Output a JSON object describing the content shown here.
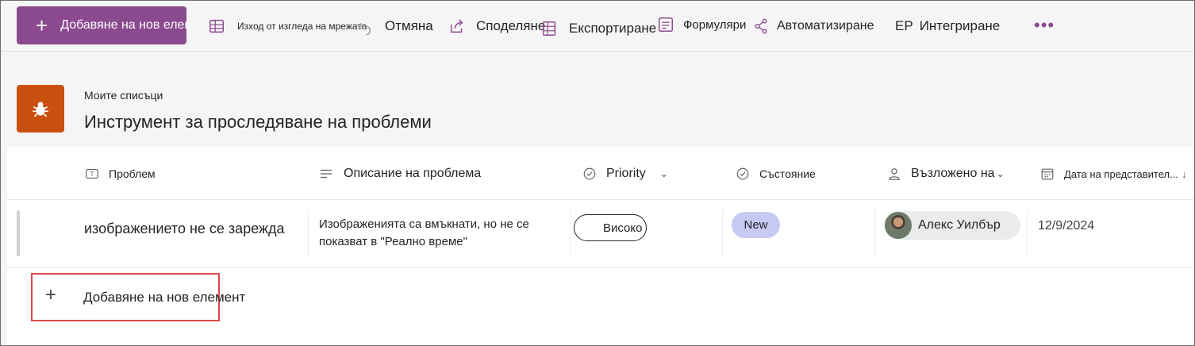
{
  "toolbar": {
    "add_new_label": "Добавяне на нов елемент",
    "exit_grid_label": "Изход от изгледа на мрежата",
    "undo_label": "Отмяна",
    "share_label": "Споделяне",
    "export_label": "Експортиране",
    "forms_label": "Формуляри",
    "automate_label": "Автоматизиране",
    "integrate_prefix": "ЕР",
    "integrate_label": "Интегриране",
    "more_label": "•••"
  },
  "header": {
    "breadcrumb": "Моите списъци",
    "title": "Инструмент за проследяване на проблеми"
  },
  "columns": [
    {
      "label": "Проблем",
      "icon": "text-icon"
    },
    {
      "label": "Описание на проблема",
      "icon": "multiline-text-icon"
    },
    {
      "label": "Priority",
      "icon": "choice-icon"
    },
    {
      "label": "Състояние",
      "icon": "choice-icon"
    },
    {
      "label": "Възложено на",
      "icon": "person-icon"
    },
    {
      "label": "Дата на представител...",
      "icon": "calendar-icon"
    }
  ],
  "rows": [
    {
      "title": "изображението не се зарежда",
      "description": "Изображенията са вмъкнати, но не се показват в \"Реално време\"",
      "priority": "Високо",
      "status": "New",
      "assigned_to": "Алекс Уилбър",
      "date": "12/9/2024"
    }
  ],
  "add_row_label": "Добавяне на нов елемент",
  "colors": {
    "accent": "#8b4a8f",
    "logo_bg": "#ca5010",
    "status_new_bg": "#c7c9f5",
    "highlight_border": "#e0484a"
  }
}
